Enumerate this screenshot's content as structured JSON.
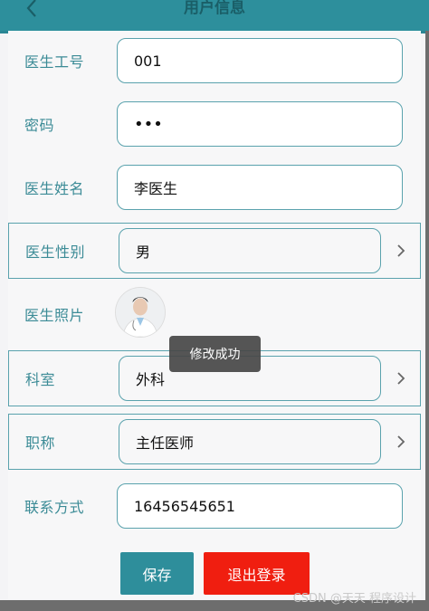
{
  "header": {
    "title": "用户信息",
    "back_icon": "chevron-left-icon"
  },
  "form": {
    "fields": [
      {
        "label": "医生工号",
        "value": "001"
      },
      {
        "label": "密码",
        "value": "•••"
      },
      {
        "label": "医生姓名",
        "value": "李医生"
      },
      {
        "label": "医生性别",
        "value": "男"
      },
      {
        "label": "医生照片"
      },
      {
        "label": "科室",
        "value": "外科"
      },
      {
        "label": "职称",
        "value": "主任医师"
      },
      {
        "label": "联系方式",
        "value": "16456545651"
      }
    ]
  },
  "toast": "修改成功",
  "buttons": {
    "save": "保存",
    "logout": "退出登录"
  },
  "watermark": "CSDN @天天 程序设计",
  "colors": {
    "accent": "#2e8e9b",
    "danger": "#f01e10",
    "label": "#3b8b96"
  }
}
